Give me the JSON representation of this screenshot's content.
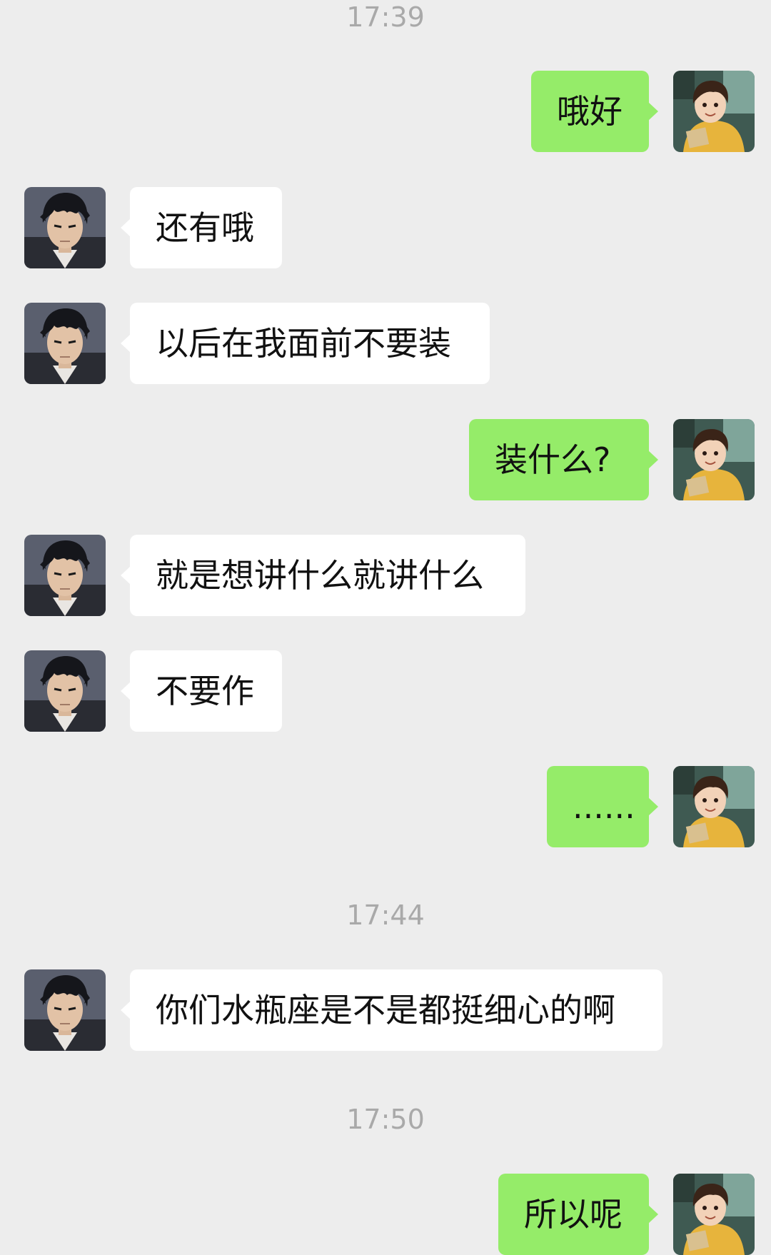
{
  "colors": {
    "background": "#ededed",
    "incoming_bubble": "#ffffff",
    "outgoing_bubble": "#95ec69",
    "timestamp_text": "#a9a9a9"
  },
  "contacts": {
    "other": {
      "avatar_icon": "anime-man-black-hair-avatar-icon"
    },
    "me": {
      "avatar_icon": "anime-girl-yellow-shirt-avatar-icon"
    }
  },
  "timestamps": [
    "17:39",
    "17:44",
    "17:50"
  ],
  "messages": [
    {
      "sender": "me",
      "text": "哦好"
    },
    {
      "sender": "other",
      "text": "还有哦"
    },
    {
      "sender": "other",
      "text": "以后在我面前不要装"
    },
    {
      "sender": "me",
      "text": "装什么?"
    },
    {
      "sender": "other",
      "text": "就是想讲什么就讲什么"
    },
    {
      "sender": "other",
      "text": "不要作"
    },
    {
      "sender": "me",
      "text": "......"
    },
    {
      "sender": "other",
      "text": "你们水瓶座是不是都挺细心的啊"
    },
    {
      "sender": "me",
      "text": "所以呢"
    }
  ]
}
